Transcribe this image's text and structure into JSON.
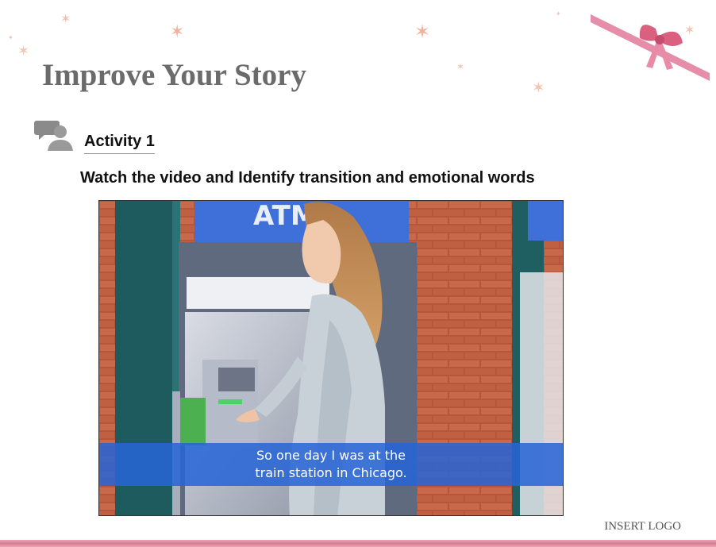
{
  "slide": {
    "title": "Improve Your Story",
    "activity_label": "Activity 1",
    "activity_icon": "chat-bubbles-icon",
    "instruction": "Watch the video and Identify transition and emotional words",
    "logo_text": "INSERT LOGO"
  },
  "video": {
    "sign_text": "ATM",
    "caption_lines": [
      "So one day I was at the",
      "train station in Chicago."
    ]
  },
  "colors": {
    "title": "#6b6b6b",
    "accent_pink": "#d77b92",
    "star_peach": "#f3b8a6",
    "caption_bar": "#2664d6",
    "atm_sign": "#3f6fd8"
  }
}
